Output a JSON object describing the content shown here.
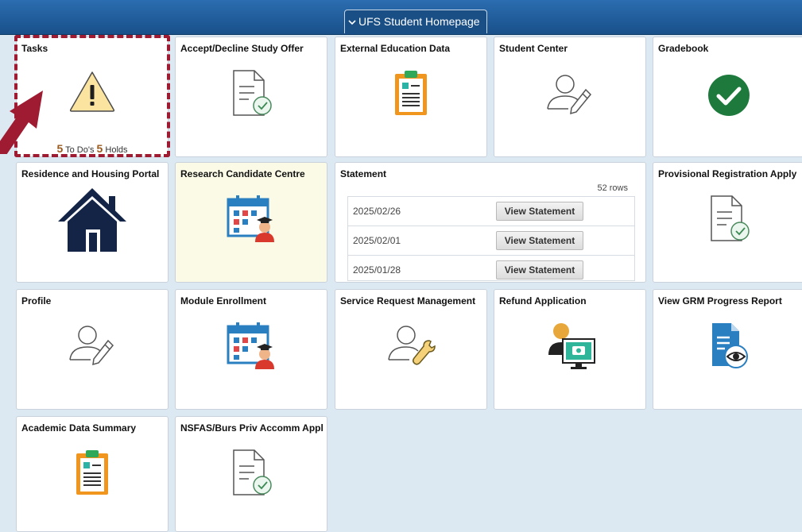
{
  "header": {
    "title": "UFS Student Homepage"
  },
  "tiles": {
    "tasks": {
      "title": "Tasks",
      "todo_count": "5",
      "todo_label": "To Do's",
      "holds_count": "5",
      "holds_label": "Holds"
    },
    "accept_decline": {
      "title": "Accept/Decline Study Offer"
    },
    "external_education": {
      "title": "External Education Data"
    },
    "student_center": {
      "title": "Student Center"
    },
    "gradebook": {
      "title": "Gradebook"
    },
    "residence": {
      "title": "Residence and Housing Portal"
    },
    "research": {
      "title": "Research Candidate Centre"
    },
    "statement": {
      "title": "Statement",
      "rows_label": "52 rows",
      "rows": [
        {
          "date": "2025/02/26",
          "button": "View Statement"
        },
        {
          "date": "2025/02/01",
          "button": "View Statement"
        },
        {
          "date": "2025/01/28",
          "button": "View Statement"
        }
      ]
    },
    "provisional": {
      "title": "Provisional Registration Apply"
    },
    "profile": {
      "title": "Profile"
    },
    "module_enrollment": {
      "title": "Module Enrollment"
    },
    "service_request": {
      "title": "Service Request Management"
    },
    "refund": {
      "title": "Refund Application"
    },
    "grm_report": {
      "title": "View GRM Progress Report"
    },
    "academic_summary": {
      "title": "Academic Data Summary"
    },
    "nsfas": {
      "title": "NSFAS/Burs Priv Accomm Appl"
    }
  },
  "colors": {
    "header_blue": "#1a4f86",
    "focus_red": "#9e1b32",
    "gradebook_green": "#1e7a3c",
    "orange": "#f0961e"
  },
  "icons": [
    "chevron-down-icon",
    "warning-icon",
    "document-check-icon",
    "clipboard-icon",
    "person-edit-icon",
    "checkmark-circle-icon",
    "house-icon",
    "calendar-graduate-icon",
    "person-wrench-icon",
    "refund-monitor-icon",
    "document-eye-icon",
    "annotation-arrow-icon"
  ]
}
